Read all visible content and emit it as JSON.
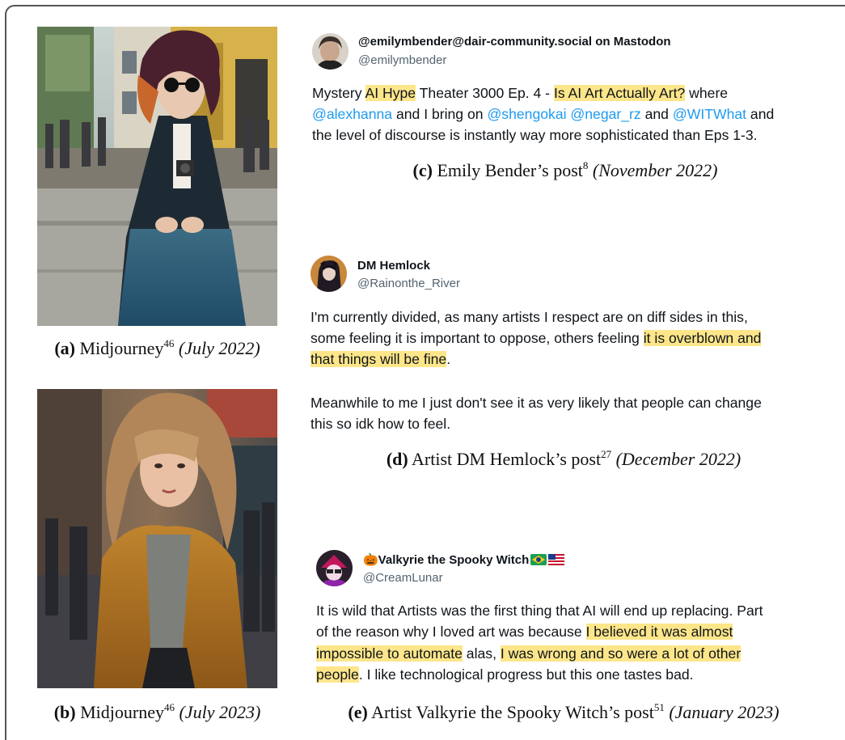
{
  "captions": {
    "a": {
      "label": "(a)",
      "title": "Midjourney",
      "ref": "46",
      "date": "(July 2022)"
    },
    "b": {
      "label": "(b)",
      "title": "Midjourney",
      "ref": "46",
      "date": "(July 2023)"
    },
    "c": {
      "label": "(c)",
      "title": "Emily Bender’s post",
      "ref": "8",
      "date": "(November 2022)"
    },
    "d": {
      "label": "(d)",
      "title": "Artist DM Hemlock’s post",
      "ref": "27",
      "date": "(December 2022)"
    },
    "e": {
      "label": "(e)",
      "title": "Artist Valkyrie the Spooky Witch’s post",
      "ref": "51",
      "date": "(January 2023)"
    }
  },
  "post_c": {
    "display_name": "@emilymbender@dair-community.social on Mastodon",
    "handle": "@emilymbender",
    "l1": {
      "t1": "Mystery ",
      "h1": "AI Hype",
      "t2": " Theater 3000 Ep. 4 - ",
      "h2": "Is AI Art Actually Art?",
      "t3": " where"
    },
    "l2": {
      "m1": "@alexhanna",
      "t1": " and I bring on ",
      "m2": "@shengokai",
      "t2": " ",
      "m3": "@negar_rz",
      "t3": " and ",
      "m4": "@WITWhat",
      "t4": " and"
    },
    "l3": "the level of discourse is instantly way more sophisticated than Eps 1-3."
  },
  "post_d": {
    "display_name": "DM Hemlock",
    "handle": "@Rainonthe_River",
    "l1": "I'm currently divided,  as many artists I respect are on diff sides in this,",
    "l2": {
      "t1": "some feeling it is important to oppose, others feeling ",
      "h1": "it is overblown and"
    },
    "l3": {
      "h1": "that things will be fine",
      "t1": "."
    },
    "l4": "Meanwhile to me I just don't see it as very likely that people can change",
    "l5": "this so idk how to feel."
  },
  "post_e": {
    "display_name": "🎃Valkyrie the Spooky Witch",
    "flag_icons": [
      "brazil-flag-icon",
      "usa-flag-icon"
    ],
    "handle": "@CreamLunar",
    "l1": "It is wild that Artists was the first thing that AI will end up replacing. Part",
    "l2": {
      "t1": "of the reason why I loved art was because ",
      "h1": "I believed it was almost"
    },
    "l3": {
      "h1": "impossible to automate",
      "t1": " alas, ",
      "h2": "I was wrong and so were a lot of other"
    },
    "l4": {
      "h1": "people",
      "t1": ". I like technological progress but this one tastes bad."
    }
  },
  "colors": {
    "highlight": "#fde68a",
    "link": "#1d9bf0",
    "handle": "#536471",
    "frame": "#555555"
  }
}
